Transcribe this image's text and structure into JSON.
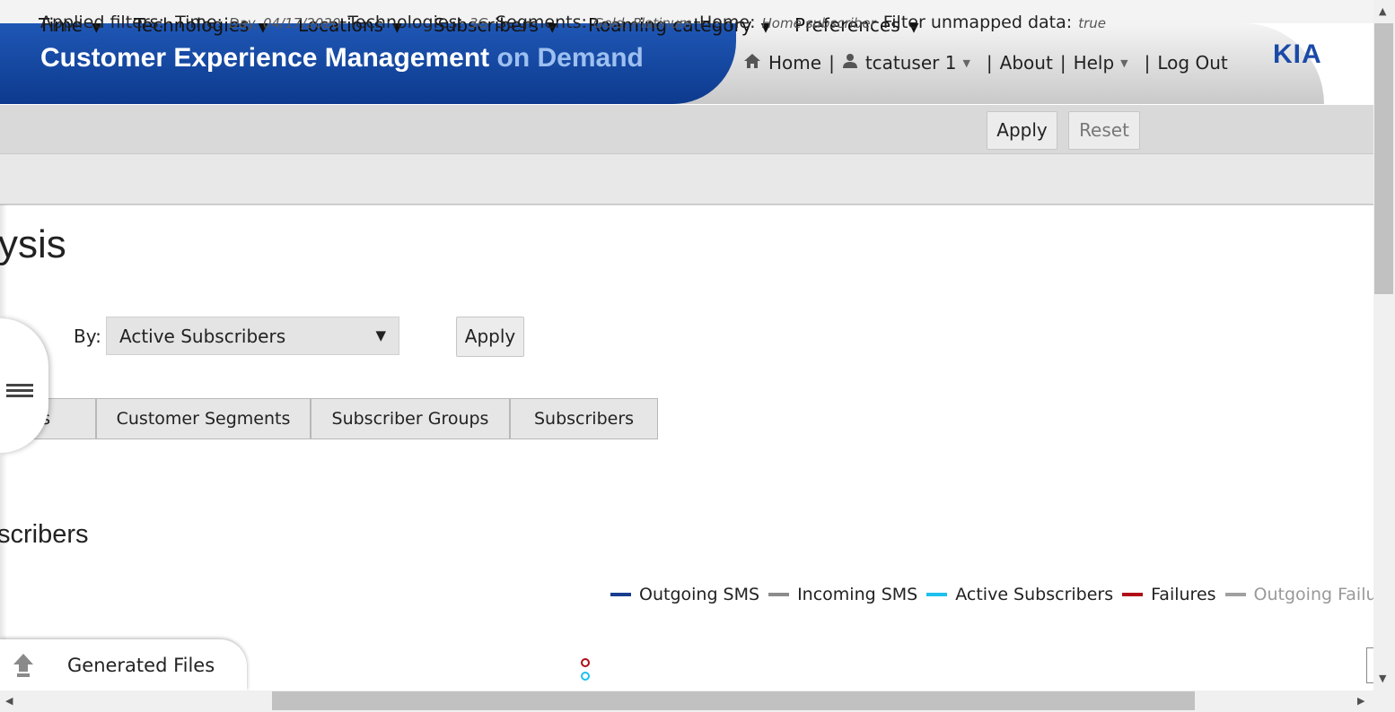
{
  "header": {
    "title_main": "Customer Experience Management",
    "title_sub": "on Demand",
    "logo_text": "KIA",
    "nav": {
      "home": "Home",
      "user": "tcatuser 1",
      "about": "About",
      "help": "Help",
      "logout": "Log Out",
      "separator": "|"
    },
    "colors": {
      "banner_blue": "#1f57b5",
      "title_sub": "#9dc0f0"
    }
  },
  "filter_menu": {
    "items": [
      {
        "label": "Time"
      },
      {
        "label": "Technologies"
      },
      {
        "label": "Locations"
      },
      {
        "label": "Subscribers"
      },
      {
        "label": "Roaming category"
      },
      {
        "label": "Preferences"
      }
    ],
    "apply_label": "Apply",
    "reset_label": "Reset"
  },
  "applied_filters": {
    "label": "Applied filters:",
    "entries": [
      {
        "key": "Time:",
        "value": "Day, 04/17/2020"
      },
      {
        "key": "Technologies:",
        "value": "3G"
      },
      {
        "key": "Segments:",
        "value": "Gold, Platinum"
      },
      {
        "key": "Home:",
        "value": "Home subscriber"
      },
      {
        "key": "Filter unmapped data:",
        "value": "true"
      }
    ]
  },
  "main": {
    "page_heading": "ysis",
    "by_label": "By:",
    "by_select_value": "Active Subscribers",
    "apply_label": "Apply",
    "tabs": [
      {
        "label": "Cells"
      },
      {
        "label": "Customer Segments"
      },
      {
        "label": "Subscriber Groups"
      },
      {
        "label": "Subscribers"
      }
    ],
    "section_heading": "scribers"
  },
  "legend": [
    {
      "label": "Outgoing SMS",
      "color": "#173d8f"
    },
    {
      "label": "Incoming SMS",
      "color": "#8c8c8c"
    },
    {
      "label": "Active Subscribers",
      "color": "#1cc1ee"
    },
    {
      "label": "Failures",
      "color": "#b00d17"
    },
    {
      "label": "Outgoing Failur",
      "color": "#a0a0a0",
      "muted": true
    }
  ],
  "generated_files": {
    "label": "Generated Files",
    "icon": "upload-arrow-icon"
  }
}
